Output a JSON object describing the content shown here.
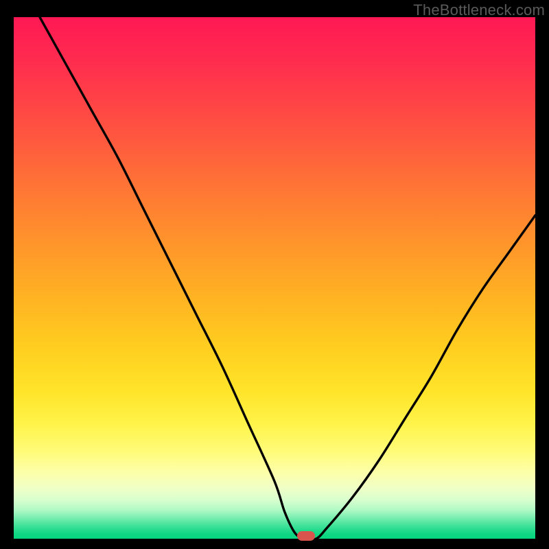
{
  "watermark": "TheBottleneck.com",
  "chart_data": {
    "type": "line",
    "title": "",
    "xlabel": "",
    "ylabel": "",
    "xlim": [
      0,
      100
    ],
    "ylim": [
      0,
      100
    ],
    "grid": false,
    "legend": false,
    "note": "V-shaped bottleneck curve on a vertical red-to-green gradient background. X axis is component performance (unlabeled), Y axis is bottleneck percentage (unlabeled). Minimum (0% bottleneck) occurs near x≈56.",
    "series": [
      {
        "name": "bottleneck_percent",
        "x": [
          5,
          10,
          15,
          20,
          25,
          30,
          35,
          40,
          45,
          50,
          52,
          54,
          56,
          58,
          60,
          65,
          70,
          75,
          80,
          85,
          90,
          95,
          100
        ],
        "values": [
          100,
          91,
          82,
          73,
          63,
          53,
          43,
          33,
          22,
          11,
          5,
          1,
          0,
          0,
          2,
          8,
          15,
          23,
          31,
          40,
          48,
          55,
          62
        ]
      }
    ],
    "marker": {
      "x": 56,
      "y": 0,
      "color": "#d9544d"
    },
    "gradient_stops": [
      {
        "pct": 0,
        "color": "#ff1854"
      },
      {
        "pct": 50,
        "color": "#ffa827"
      },
      {
        "pct": 80,
        "color": "#fff556"
      },
      {
        "pct": 100,
        "color": "#06d57f"
      }
    ]
  }
}
